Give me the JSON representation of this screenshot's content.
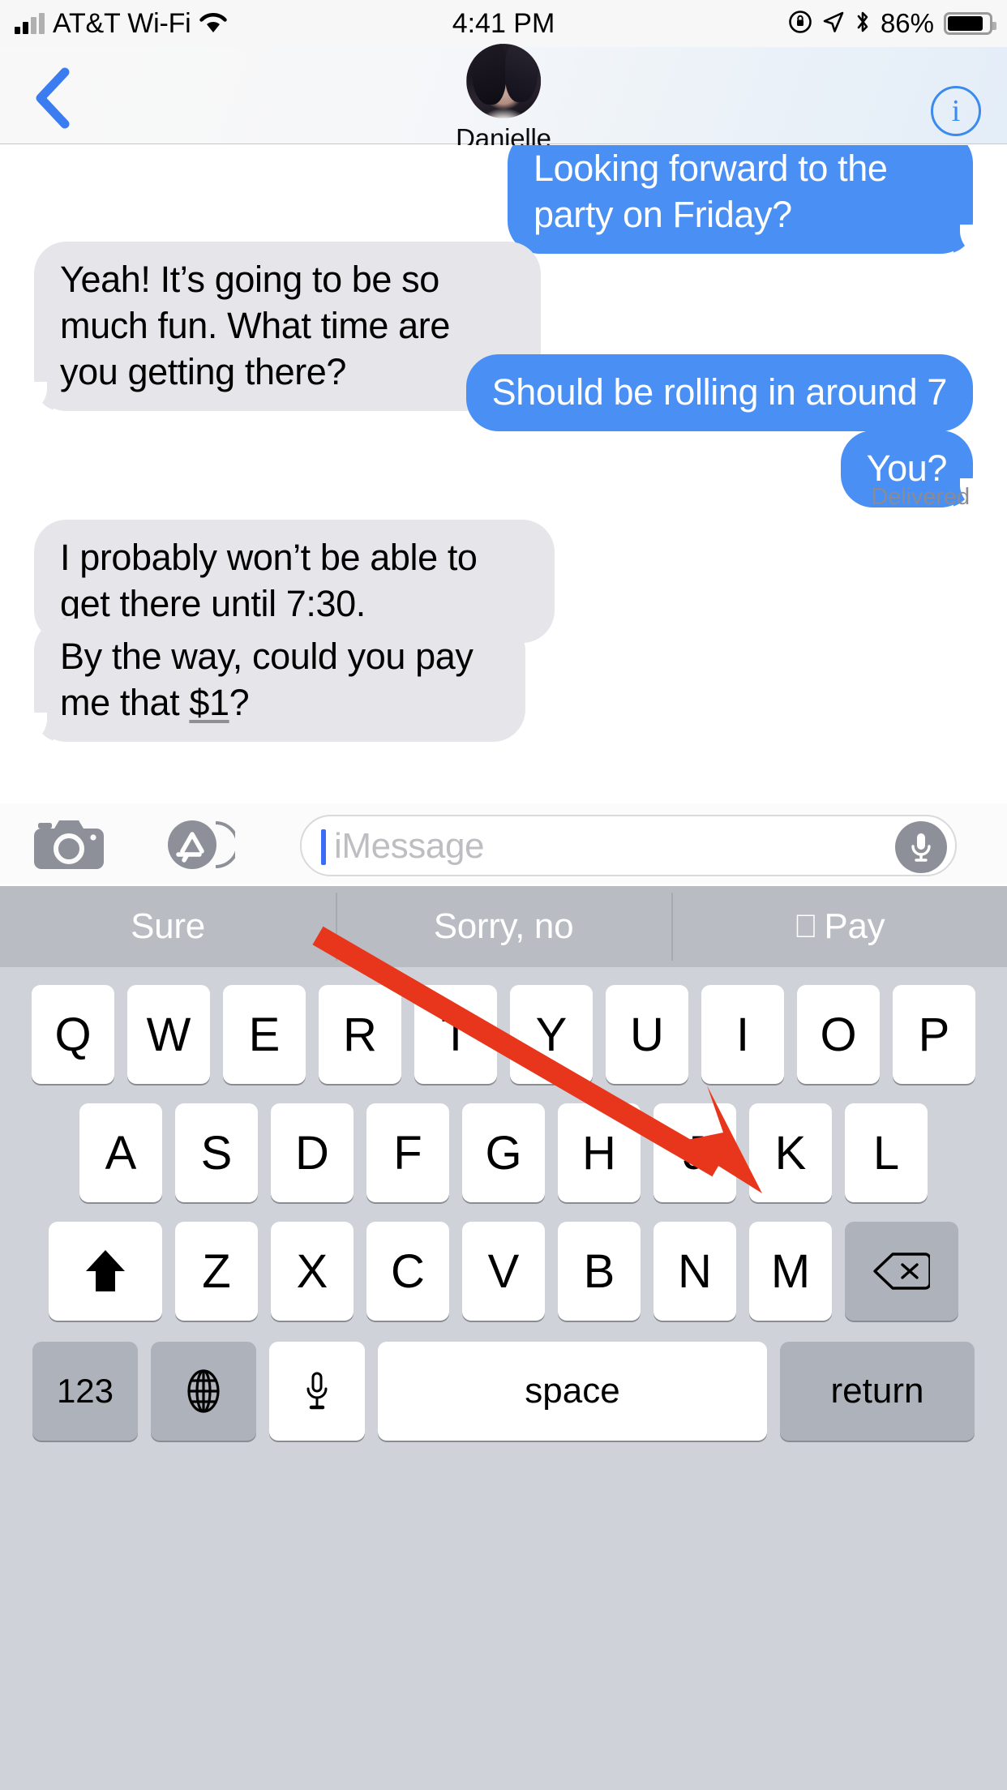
{
  "status_bar": {
    "carrier": "AT&T Wi-Fi",
    "time": "4:41 PM",
    "battery_percent": "86%",
    "icons": [
      "signal-bars-icon",
      "wifi-icon",
      "rotation-lock-icon",
      "location-arrow-icon",
      "bluetooth-icon",
      "battery-icon"
    ]
  },
  "nav_header": {
    "back_label": "back-chevron",
    "contact_name": "Danielle",
    "info_label": "i"
  },
  "conversation": {
    "messages": [
      {
        "id": "m1",
        "side": "sent",
        "text": "Looking forward to the party on Friday?"
      },
      {
        "id": "m2",
        "side": "received",
        "text": "Yeah! It’s going to be so much fun. What time are you getting there?"
      },
      {
        "id": "m3",
        "side": "sent",
        "text": "Should be rolling in around 7"
      },
      {
        "id": "m4",
        "side": "sent",
        "text": "You?"
      },
      {
        "id": "m5",
        "side": "received",
        "text_prefix": "I probably won’t be able to get there ",
        "text_link": "until 7:30",
        "text_suffix": "."
      },
      {
        "id": "m6",
        "side": "received",
        "text_prefix": "By the way, could you pay me that ",
        "text_link": "$1",
        "text_suffix": "?"
      }
    ],
    "delivery_status": "Delivered"
  },
  "input_toolbar": {
    "camera_label": "camera-icon",
    "appstore_label": "app-store-icon",
    "placeholder": "iMessage",
    "value": "",
    "mic_label": "microphone-icon"
  },
  "predictive_bar": {
    "suggestions": [
      {
        "label": "Sure",
        "icon": ""
      },
      {
        "label": "Sorry, no",
        "icon": ""
      },
      {
        "label": "Pay",
        "icon": "apple-logo-icon"
      }
    ]
  },
  "keyboard": {
    "row1": [
      "Q",
      "W",
      "E",
      "R",
      "T",
      "Y",
      "U",
      "I",
      "O",
      "P"
    ],
    "row2": [
      "A",
      "S",
      "D",
      "F",
      "G",
      "H",
      "J",
      "K",
      "L"
    ],
    "row3_letters": [
      "Z",
      "X",
      "C",
      "V",
      "B",
      "N",
      "M"
    ],
    "shift_label": "shift-arrow-icon",
    "delete_label": "delete-backspace-icon",
    "numbers_label": "123",
    "globe_label": "globe-icon",
    "dictation_label": "microphone-icon",
    "space_label": "space",
    "return_label": "return"
  },
  "annotation": {
    "arrow_color": "#e8361c",
    "points_to": "apple-pay-suggestion"
  },
  "colors": {
    "sent_bubble": "#4a90f4",
    "received_bubble": "#e5e5ea",
    "accent_blue": "#3b8aee",
    "keyboard_bg": "#cfd2d8",
    "predictive_bg": "#b9bcc2"
  }
}
